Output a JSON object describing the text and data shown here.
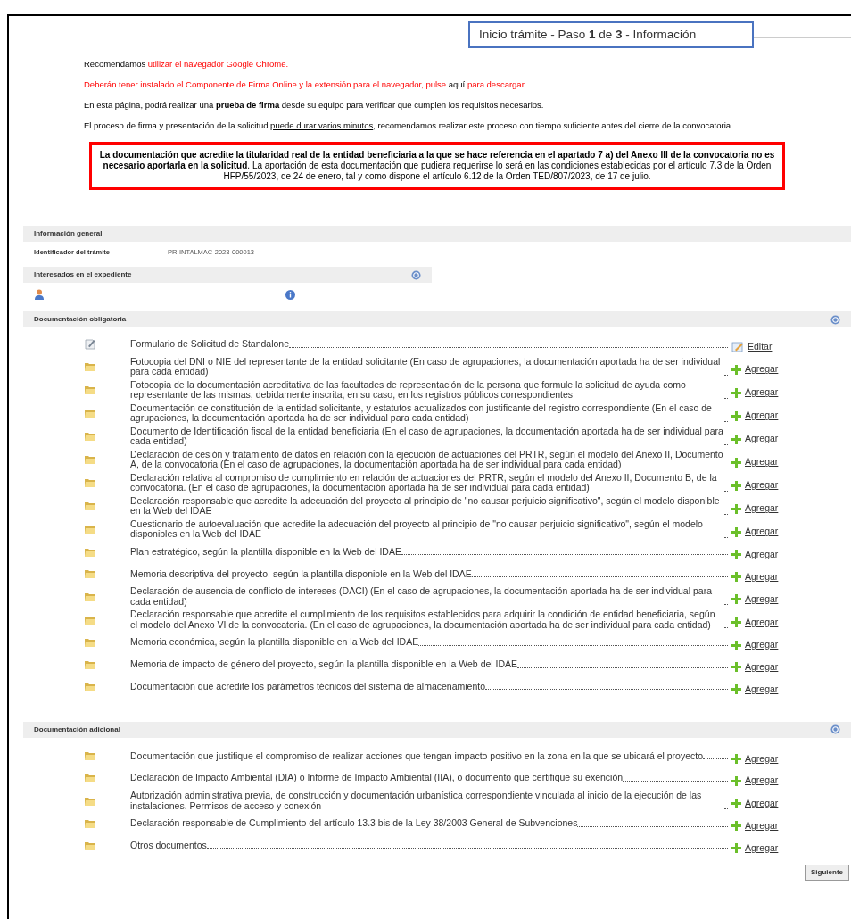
{
  "header": {
    "title": "Inicio trámite - Paso **1** de **3** - Información"
  },
  "intro": [
    [
      {
        "kind": "plain",
        "text": "Recomendamos "
      },
      {
        "kind": "red",
        "text": "utilizar el navegador Google Chrome."
      }
    ],
    [
      {
        "kind": "red",
        "text": "Deberán tener instalado el Componente de Firma Online y la extensión para el navegador, pulse "
      },
      {
        "kind": "link",
        "text": "aquí"
      },
      {
        "kind": "red",
        "text": " para descargar."
      }
    ],
    [
      {
        "kind": "plain",
        "text": "En esta página, podrá realizar una "
      },
      {
        "kind": "bold",
        "text": "prueba de firma"
      },
      {
        "kind": "plain",
        "text": " desde su equipo para verificar que cumplen los requisitos necesarios."
      }
    ],
    [
      {
        "kind": "plain",
        "text": "El proceso de firma y presentación de la solicitud "
      },
      {
        "kind": "underline",
        "text": "puede durar varios minutos"
      },
      {
        "kind": "plain",
        "text": ", recomendamos realizar este proceso con tiempo suficiente antes del cierre de la convocatoria."
      }
    ]
  ],
  "notice": "**La documentación que acredite la titularidad real de la entidad beneficiaria a la que se hace referencia en el apartado 7 a) del Anexo III de la convocatoria no es necesario aportarla en la solicitud**. La aportación de esta documentación que pudiera requerirse lo será en las condiciones establecidas por el artículo 7.3 de la Orden HFP/55/2023, de 24 de enero, tal y como dispone el artículo 6.12 de la Orden TED/807/2023, de 17 de julio.",
  "general": {
    "title": "Información general",
    "label": "Identificador del trámite",
    "value": "PR-INTALMAC-2023-000013"
  },
  "interested": {
    "title": "Interesados en el expediente"
  },
  "sections": [
    {
      "title": "Documentación obligatoria",
      "items": [
        {
          "kind": "form",
          "text": "Formulario de Solicitud de Standalone",
          "action": "Editar"
        },
        {
          "kind": "doc",
          "text": "Fotocopia del DNI o NIE del representante de la entidad solicitante (En caso de agrupaciones, la documentación aportada ha de ser individual para cada entidad)",
          "action": "Agregar"
        },
        {
          "kind": "doc",
          "text": "Fotocopia de la documentación acreditativa de las facultades de representación de la persona que formule la solicitud de ayuda como representante de las mismas, debidamente inscrita, en su caso, en los registros públicos correspondientes",
          "action": "Agregar"
        },
        {
          "kind": "doc",
          "text": "Documentación de constitución de la entidad solicitante, y estatutos actualizados con justificante del registro correspondiente (En el caso de agrupaciones, la documentación aportada ha de ser individual para cada entidad)",
          "action": "Agregar"
        },
        {
          "kind": "doc",
          "text": "Documento de Identificación fiscal de la entidad beneficiaria (En el caso de agrupaciones, la documentación aportada ha de ser individual para cada entidad)",
          "action": "Agregar"
        },
        {
          "kind": "doc",
          "text": "Declaración de cesión y tratamiento de datos en relación con la ejecución de actuaciones del PRTR, según el modelo del Anexo II, Documento A, de la convocatoria (En el caso de agrupaciones, la documentación aportada ha de ser individual para cada entidad)",
          "action": "Agregar"
        },
        {
          "kind": "doc",
          "text": "Declaración relativa al compromiso de cumplimiento en relación de actuaciones del PRTR, según el modelo del Anexo II, Documento B, de la convocatoria. (En el caso de agrupaciones, la documentación aportada ha de ser individual para cada entidad)",
          "action": "Agregar"
        },
        {
          "kind": "doc",
          "text": "Declaración responsable que acredite la adecuación del proyecto al principio de \"no causar perjuicio significativo\", según el modelo disponible en la Web del IDAE",
          "action": "Agregar"
        },
        {
          "kind": "doc",
          "text": "Cuestionario de autoevaluación que acredite la adecuación del proyecto al principio de \"no causar perjuicio significativo\", según el modelo disponibles en la Web del IDAE",
          "action": "Agregar"
        },
        {
          "kind": "doc",
          "text": "Plan estratégico, según la plantilla disponible en la Web del IDAE",
          "action": "Agregar"
        },
        {
          "kind": "doc",
          "text": "Memoria descriptiva del proyecto, según la plantilla disponible en la Web del IDAE",
          "action": "Agregar"
        },
        {
          "kind": "doc",
          "text": "Declaración de ausencia de conflicto de intereses (DACI) (En el caso de agrupaciones, la documentación aportada ha de ser individual para cada entidad)",
          "action": "Agregar"
        },
        {
          "kind": "doc",
          "text": "Declaración responsable que acredite el cumplimiento de los requisitos establecidos para adquirir la condición de entidad beneficiaria, según el modelo del Anexo VI de la convocatoria. (En el caso de agrupaciones, la documentación aportada ha de ser individual para cada entidad)",
          "action": "Agregar"
        },
        {
          "kind": "doc",
          "text": "Memoria económica, según la plantilla disponible en la Web del IDAE",
          "action": "Agregar"
        },
        {
          "kind": "doc",
          "text": "Memoria de impacto de género del proyecto, según la plantilla disponible en la Web del IDAE",
          "action": "Agregar"
        },
        {
          "kind": "doc",
          "text": "Documentación que acredite los parámetros técnicos del sistema de almacenamiento",
          "action": "Agregar"
        }
      ]
    },
    {
      "title": "Documentación adicional",
      "items": [
        {
          "kind": "doc",
          "text": "Documentación que justifique el compromiso de realizar acciones que tengan impacto positivo en la zona en la que se ubicará el proyecto",
          "action": "Agregar"
        },
        {
          "kind": "doc",
          "text": "Declaración de Impacto Ambiental (DIA) o Informe de Impacto Ambiental (IIA), o documento que certifique su exención",
          "action": "Agregar"
        },
        {
          "kind": "doc",
          "text": "Autorización administrativa previa, de construcción y documentación urbanística correspondiente vinculada al inicio de la ejecución de las instalaciones. Permisos de acceso y conexión",
          "action": "Agregar"
        },
        {
          "kind": "doc",
          "text": "Declaración responsable de Cumplimiento del artículo 13.3 bis de la Ley 38/2003 General de Subvenciones",
          "action": "Agregar"
        },
        {
          "kind": "doc",
          "text": "Otros documentos",
          "action": "Agregar"
        }
      ]
    }
  ],
  "next_button": "Siguiente"
}
